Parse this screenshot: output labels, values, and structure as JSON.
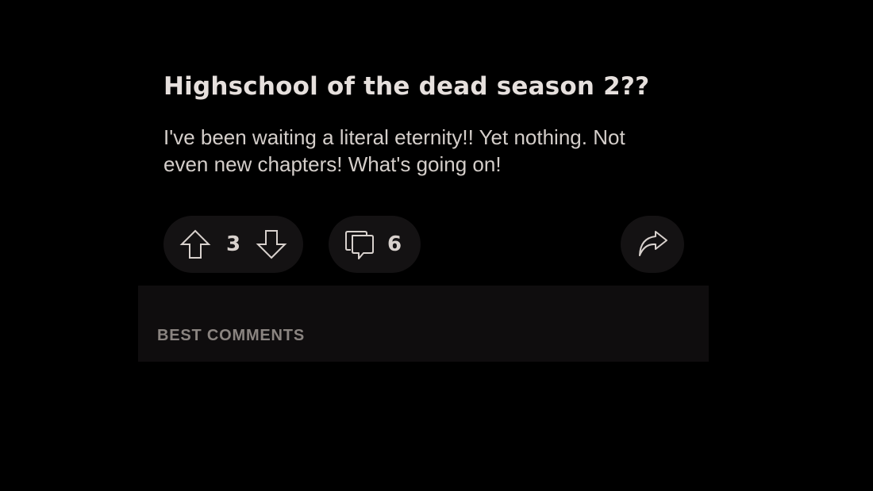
{
  "post": {
    "title": "Highschool of the dead season 2??",
    "body": "I've been waiting a literal eternity!! Yet nothing. Not even new chapters! What's going on!"
  },
  "actions": {
    "upvote_icon": "arrow-up-icon",
    "downvote_icon": "arrow-down-icon",
    "vote_count": "3",
    "comment_icon": "comments-icon",
    "comment_count": "6",
    "share_icon": "share-icon"
  },
  "comments": {
    "heading": "BEST COMMENTS"
  },
  "colors": {
    "background": "#000000",
    "pill": "#141213",
    "text": "#e6e0dd",
    "muted": "#8a8480",
    "section": "#0f0d0e"
  }
}
